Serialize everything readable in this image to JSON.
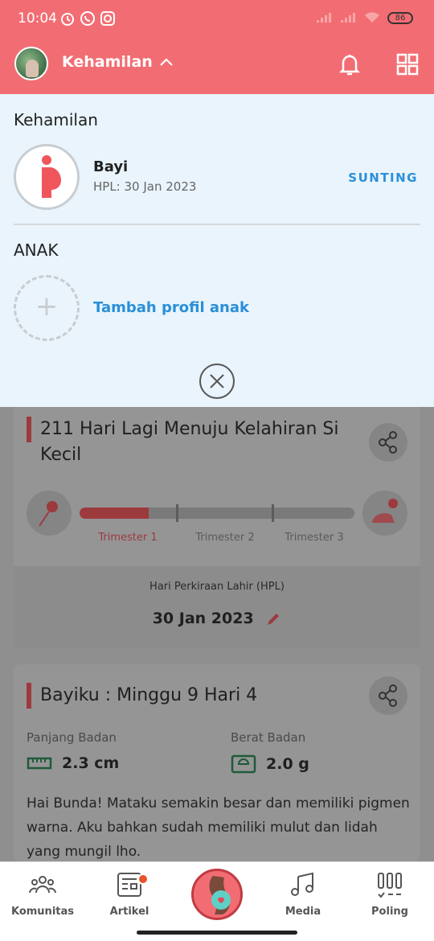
{
  "status_bar": {
    "time": "10:04",
    "battery": "86"
  },
  "header": {
    "title": "Kehamilan"
  },
  "panel": {
    "pregnancy_section": "Kehamilan",
    "baby_name": "Bayi",
    "baby_hpl": "HPL: 30 Jan 2023",
    "edit_label": "SUNTING",
    "children_section": "ANAK",
    "add_child_label": "Tambah profil anak"
  },
  "countdown_card": {
    "title_line1": "211 Hari Lagi Menuju Kelahiran Si",
    "title_line2": "Kecil",
    "trimesters": [
      "Trimester 1",
      "Trimester 2",
      "Trimester 3"
    ],
    "active_trimester": 1,
    "progress_fraction": 0.25,
    "hpl_label": "Hari Perkiraan Lahir (HPL)",
    "hpl_date": "30 Jan 2023"
  },
  "baby_card": {
    "title": "Bayiku : Minggu 9 Hari 4",
    "length_label": "Panjang Badan",
    "length_value": "2.3 cm",
    "weight_label": "Berat Badan",
    "weight_value": "2.0 g",
    "description": "Hai Bunda! Mataku semakin besar dan memiliki pigmen warna. Aku bahkan sudah memiliki mulut dan lidah yang mungil lho."
  },
  "bottom_nav": {
    "items": [
      {
        "label": "Komunitas",
        "icon": "people-icon"
      },
      {
        "label": "Artikel",
        "icon": "article-icon",
        "badge": true
      },
      {
        "label": "",
        "icon": "pregnancy-icon"
      },
      {
        "label": "Media",
        "icon": "music-note-icon"
      },
      {
        "label": "Poling",
        "icon": "poll-icon"
      }
    ]
  },
  "colors": {
    "brand": "#f26d73",
    "link": "#2a8fd8",
    "panel_bg": "#e9f4fc"
  }
}
